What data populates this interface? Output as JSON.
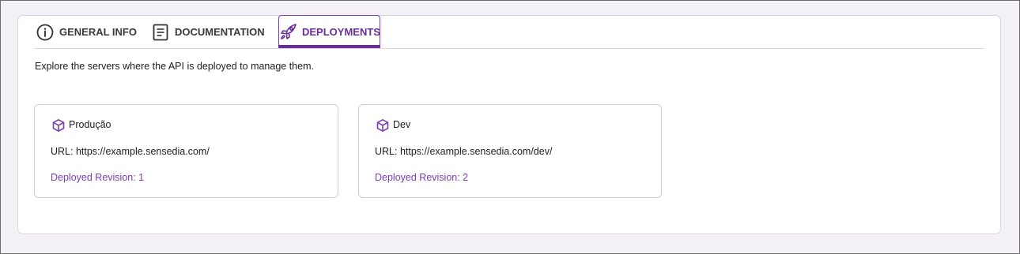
{
  "tabs": [
    {
      "label": "GENERAL INFO",
      "icon": "info-circle-icon",
      "active": false
    },
    {
      "label": "DOCUMENTATION",
      "icon": "document-icon",
      "active": false
    },
    {
      "label": "DEPLOYMENTS",
      "icon": "rocket-icon",
      "active": true
    }
  ],
  "intro": "Explore the servers where the API is deployed to manage them.",
  "deployments": [
    {
      "name": "Produção",
      "icon": "cube-icon",
      "url": "URL: https://example.sensedia.com/",
      "revision": "Deployed Revision: 1"
    },
    {
      "name": "Dev",
      "icon": "cube-icon",
      "url": "URL: https://example.sensedia.com/dev/",
      "revision": "Deployed Revision: 2"
    }
  ],
  "colors": {
    "accent": "#6a2c9c",
    "link": "#7a3db3",
    "background": "#f3f1f6"
  }
}
